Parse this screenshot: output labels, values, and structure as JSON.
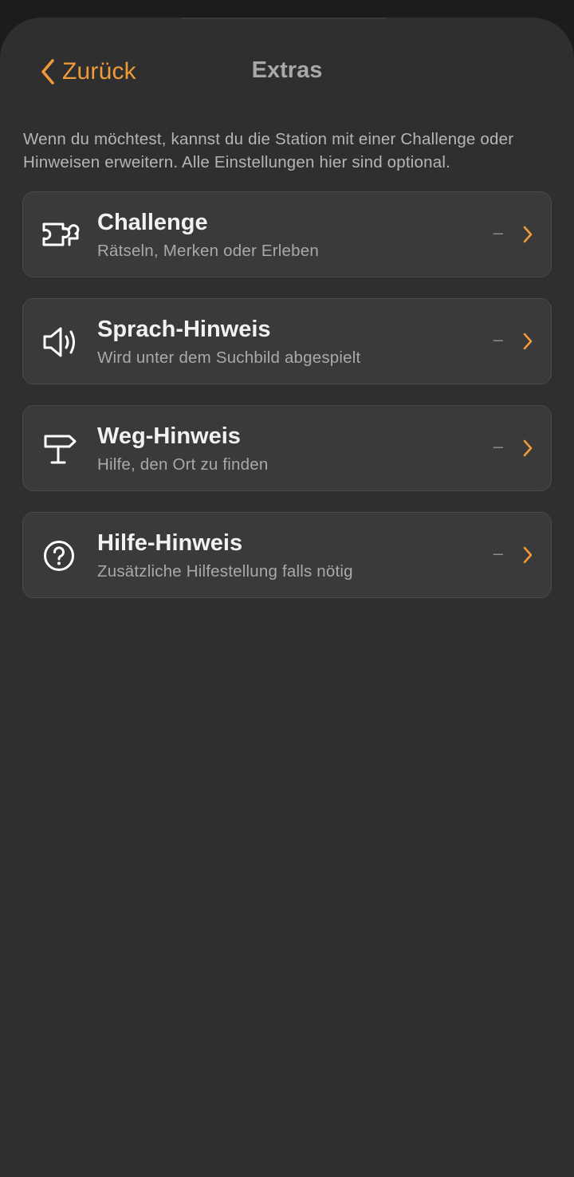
{
  "nav": {
    "back_label": "Zurück",
    "title": "Extras"
  },
  "intro_text": "Wenn du möchtest, kannst du die Station mit einer Challenge oder Hinweisen erweitern. Alle Einstellungen hier sind optional.",
  "accent_color": "#f09a38",
  "items": [
    {
      "icon": "puzzle-icon",
      "title": "Challenge",
      "subtitle": "Rätseln, Merken oder Erleben",
      "value": "–"
    },
    {
      "icon": "speaker-icon",
      "title": "Sprach-Hinweis",
      "subtitle": "Wird unter dem Suchbild abgespielt",
      "value": "–"
    },
    {
      "icon": "signpost-icon",
      "title": "Weg-Hinweis",
      "subtitle": "Hilfe, den Ort zu finden",
      "value": "–"
    },
    {
      "icon": "question-circle-icon",
      "title": "Hilfe-Hinweis",
      "subtitle": "Zusätzliche Hilfestellung falls nötig",
      "value": "–"
    }
  ]
}
